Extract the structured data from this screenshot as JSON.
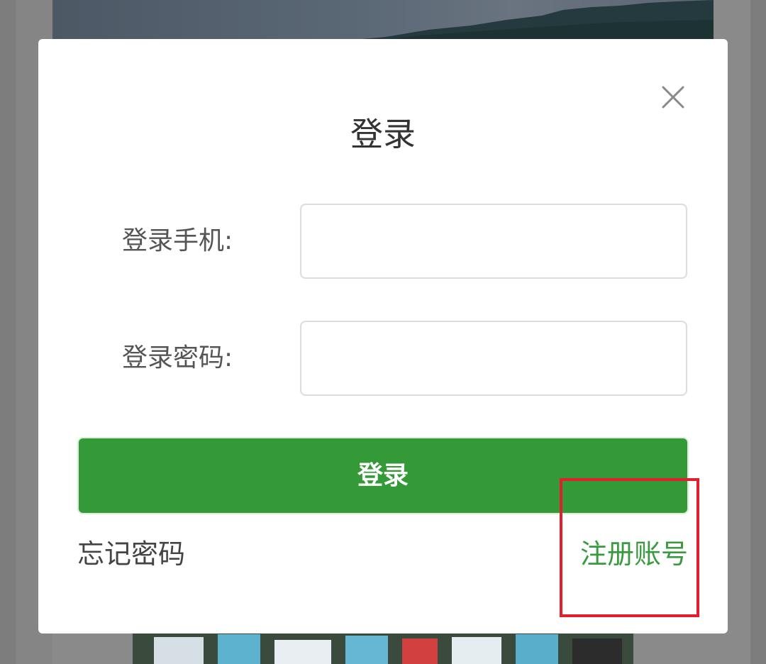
{
  "dialog": {
    "title": "登录",
    "close_icon": "close-icon"
  },
  "form": {
    "phone_label": "登录手机:",
    "phone_value": "",
    "password_label": "登录密码:",
    "password_value": "",
    "submit_label": "登录"
  },
  "links": {
    "forgot_password": "忘记密码",
    "register": "注册账号"
  },
  "colors": {
    "accent": "#339a37",
    "register_link": "#3a9a3f",
    "highlight": "#e0202e",
    "overlay": "#7d7d7d"
  }
}
